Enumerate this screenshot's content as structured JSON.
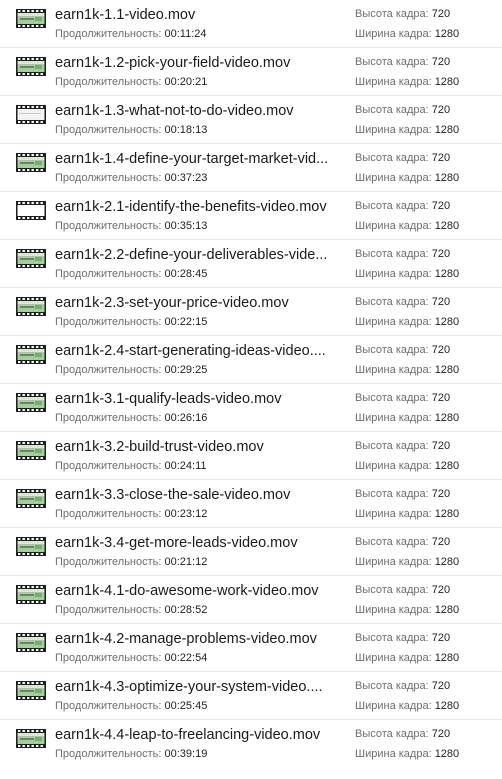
{
  "labels": {
    "duration": "Продолжительность:",
    "frame_height": "Высота кадра:",
    "frame_width": "Ширина кадра:"
  },
  "icons": {
    "video_thumbnail": "video-file-icon",
    "blank_video": "film-strip-icon"
  },
  "colors": {
    "row_divider": "#e6e6e6",
    "label_gray": "#6d6d6d",
    "text": "#1a1a1a",
    "thumb_green": "#a9c9a4"
  },
  "files": [
    {
      "name": "earn1k-1.1-video.mov",
      "duration": "00:11:24",
      "frame_height": "720",
      "frame_width": "1280",
      "thumb": "green"
    },
    {
      "name": "earn1k-1.2-pick-your-field-video.mov",
      "duration": "00:20:21",
      "frame_height": "720",
      "frame_width": "1280",
      "thumb": "green"
    },
    {
      "name": "earn1k-1.3-what-not-to-do-video.mov",
      "duration": "00:18:13",
      "frame_height": "720",
      "frame_width": "1280",
      "thumb": "white"
    },
    {
      "name": "earn1k-1.4-define-your-target-market-vid...",
      "duration": "00:37:23",
      "frame_height": "720",
      "frame_width": "1280",
      "thumb": "green"
    },
    {
      "name": "earn1k-2.1-identify-the-benefits-video.mov",
      "duration": "00:35:13",
      "frame_height": "720",
      "frame_width": "1280",
      "thumb": "blank"
    },
    {
      "name": "earn1k-2.2-define-your-deliverables-vide...",
      "duration": "00:28:45",
      "frame_height": "720",
      "frame_width": "1280",
      "thumb": "green"
    },
    {
      "name": "earn1k-2.3-set-your-price-video.mov",
      "duration": "00:22:15",
      "frame_height": "720",
      "frame_width": "1280",
      "thumb": "green"
    },
    {
      "name": "earn1k-2.4-start-generating-ideas-video....",
      "duration": "00:29:25",
      "frame_height": "720",
      "frame_width": "1280",
      "thumb": "green"
    },
    {
      "name": "earn1k-3.1-qualify-leads-video.mov",
      "duration": "00:26:16",
      "frame_height": "720",
      "frame_width": "1280",
      "thumb": "green"
    },
    {
      "name": "earn1k-3.2-build-trust-video.mov",
      "duration": "00:24:11",
      "frame_height": "720",
      "frame_width": "1280",
      "thumb": "green"
    },
    {
      "name": "earn1k-3.3-close-the-sale-video.mov",
      "duration": "00:23:12",
      "frame_height": "720",
      "frame_width": "1280",
      "thumb": "green"
    },
    {
      "name": "earn1k-3.4-get-more-leads-video.mov",
      "duration": "00:21:12",
      "frame_height": "720",
      "frame_width": "1280",
      "thumb": "green"
    },
    {
      "name": "earn1k-4.1-do-awesome-work-video.mov",
      "duration": "00:28:52",
      "frame_height": "720",
      "frame_width": "1280",
      "thumb": "green"
    },
    {
      "name": "earn1k-4.2-manage-problems-video.mov",
      "duration": "00:22:54",
      "frame_height": "720",
      "frame_width": "1280",
      "thumb": "green"
    },
    {
      "name": "earn1k-4.3-optimize-your-system-video....",
      "duration": "00:25:45",
      "frame_height": "720",
      "frame_width": "1280",
      "thumb": "green"
    },
    {
      "name": "earn1k-4.4-leap-to-freelancing-video.mov",
      "duration": "00:39:19",
      "frame_height": "720",
      "frame_width": "1280",
      "thumb": "green"
    }
  ]
}
